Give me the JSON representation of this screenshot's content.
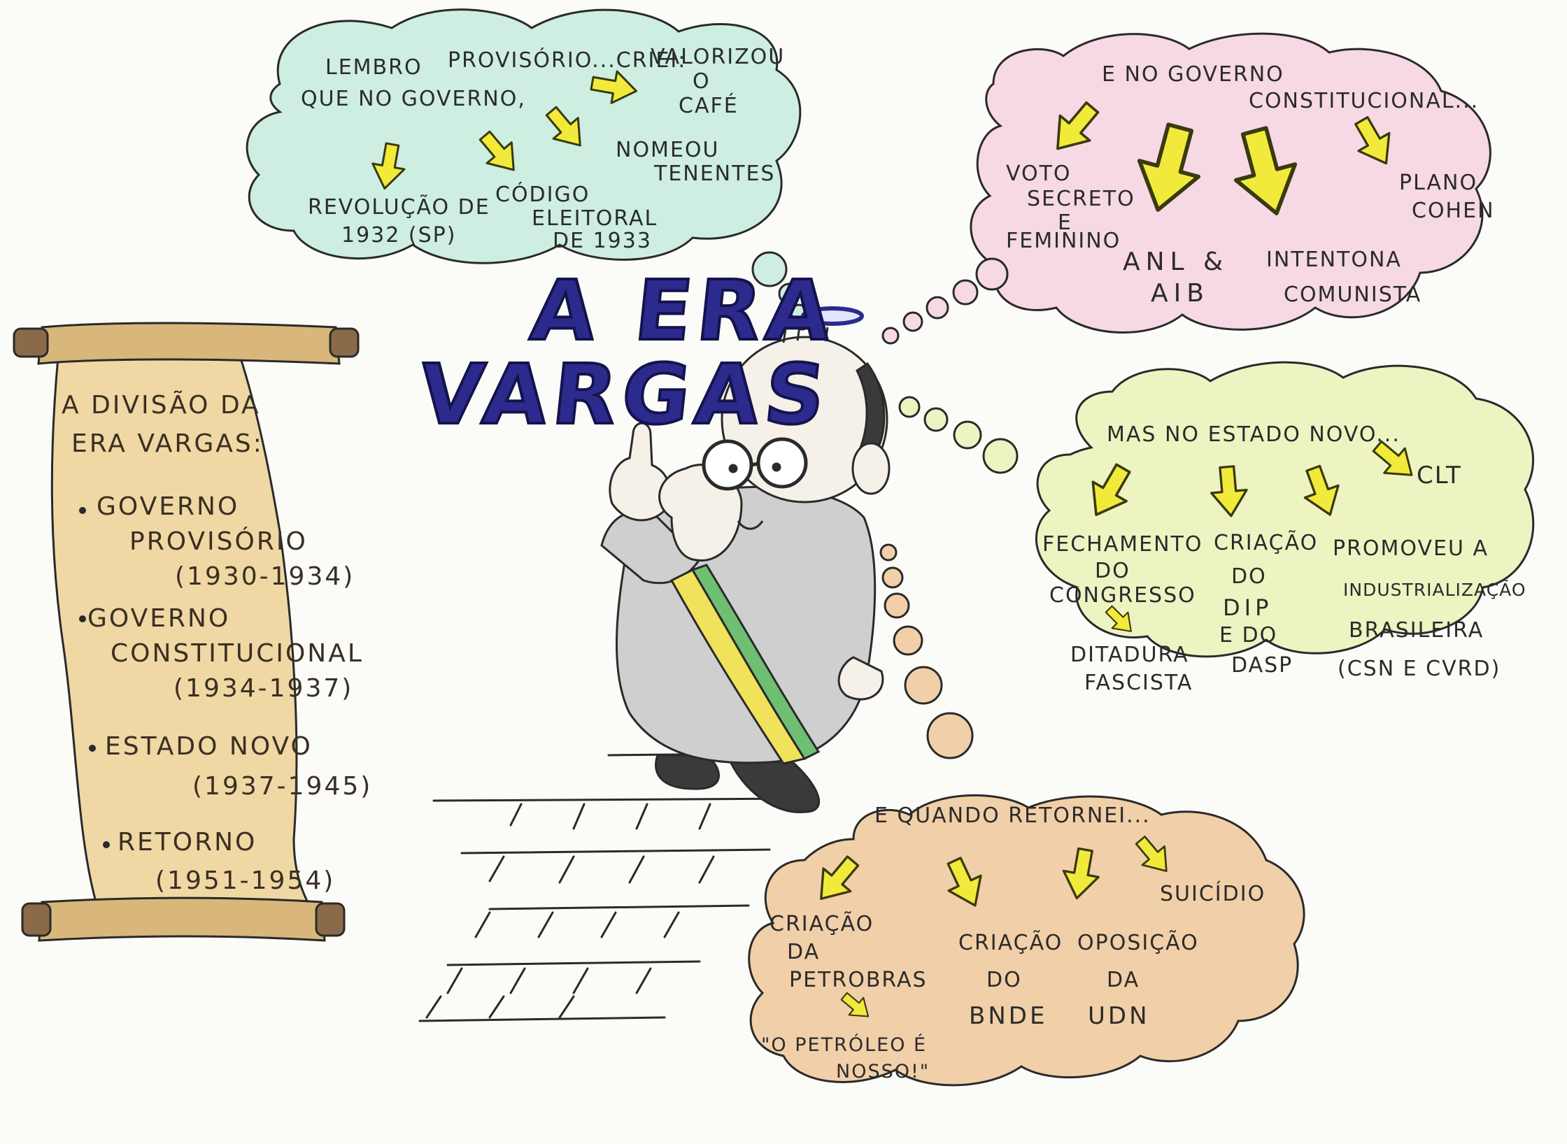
{
  "title": {
    "line1": "A ERA",
    "line2": "VARGAS"
  },
  "scroll": {
    "heading_line1": "A DIVISÃO DA",
    "heading_line2": "ERA VARGAS:",
    "items": [
      {
        "name_line1": "GOVERNO",
        "name_line2": "PROVISÓRIO",
        "years": "(1930-1934)"
      },
      {
        "name_line1": "GOVERNO",
        "name_line2": "CONSTITUCIONAL",
        "years": "(1934-1937)"
      },
      {
        "name_line1": "ESTADO NOVO",
        "name_line2": "",
        "years": "(1937-1945)"
      },
      {
        "name_line1": "RETORNO",
        "name_line2": "",
        "years": "(1951-1954)"
      }
    ]
  },
  "bubble_provisorio": {
    "intro_line1": "LEMBRO",
    "intro_line2": "QUE NO GOVERNO,",
    "intro_line3": "PROVISÓRIO...CRIEI:",
    "valorizou_line1": "VALORIZOU",
    "valorizou_line2": "O",
    "valorizou_line3": "CAFÉ",
    "nomeou_line1": "NOMEOU",
    "nomeou_line2": "TENENTES",
    "revolucao_line1": "REVOLUÇÃO DE",
    "revolucao_line2": "1932 (SP)",
    "codigo_line1": "CÓDIGO",
    "codigo_line2": "ELEITORAL",
    "codigo_line3": "DE 1933"
  },
  "bubble_constitucional": {
    "intro_line1": "E NO GOVERNO",
    "intro_line2": "CONSTITUCIONAL...",
    "voto_line1": "VOTO",
    "voto_line2": "SECRETO",
    "voto_line3": "E",
    "voto_line4": "FEMININO",
    "anl_line1": "ANL &",
    "anl_line2": "AIB",
    "intentona_line1": "INTENTONA",
    "intentona_line2": "COMUNISTA",
    "plano_line1": "PLANO",
    "plano_line2": "COHEN"
  },
  "bubble_estado_novo": {
    "intro": "MAS NO ESTADO NOVO...",
    "clt": "CLT",
    "fechamento_line1": "FECHAMENTO",
    "fechamento_line2": "DO",
    "fechamento_line3": "CONGRESSO",
    "ditadura_line1": "DITADURA",
    "ditadura_line2": "FASCISTA",
    "dip_line1": "CRIAÇÃO",
    "dip_line2": "DO",
    "dip_line3": "DIP",
    "dip_line4": "E DO",
    "dip_line5": "DASP",
    "ind_line1": "PROMOVEU A",
    "ind_line2": "INDUSTRIALIZAÇÃO",
    "ind_line3": "BRASILEIRA",
    "ind_line4": "(CSN E CVRD)"
  },
  "bubble_retorno": {
    "intro": "E QUANDO RETORNEI...",
    "suicidio": "SUICÍDIO",
    "petrobras_line1": "CRIAÇÃO",
    "petrobras_line2": "DA",
    "petrobras_line3": "PETROBRAS",
    "slogan_line1": "\"O PETRÓLEO É",
    "slogan_line2": "NOSSO!\"",
    "bnde_line1": "CRIAÇÃO",
    "bnde_line2": "DO",
    "bnde_line3": "BNDE",
    "udn_line1": "OPOSIÇÃO",
    "udn_line2": "DA",
    "udn_line3": "UDN"
  },
  "colors": {
    "bubble_provisorio": "#cdeee1",
    "bubble_constitucional": "#f6d9e4",
    "bubble_estado_novo": "#eef3c2",
    "bubble_retorno": "#f1cfa8",
    "scroll": "#efd8a4",
    "arrow_fill": "#f2ea3a",
    "title": "#2c2a8c",
    "sash_green": "#6fbf73",
    "sash_yellow": "#f0e25a"
  }
}
